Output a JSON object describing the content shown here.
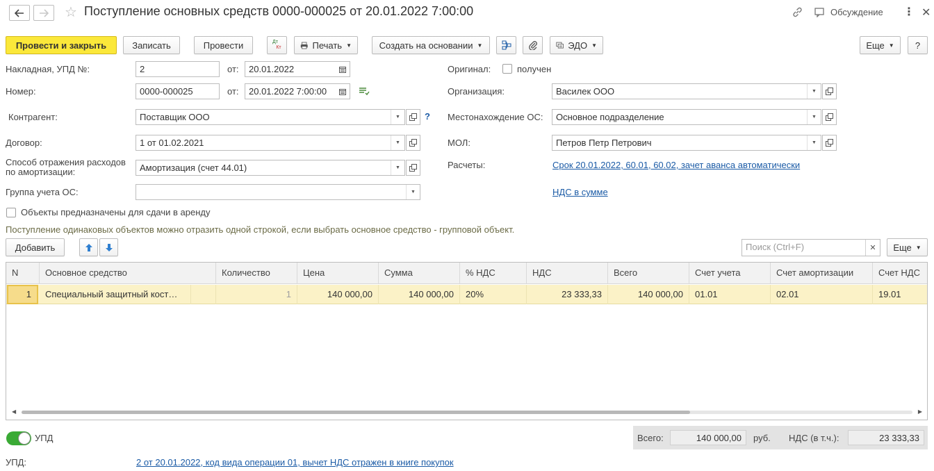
{
  "window": {
    "title": "Поступление основных средств 0000-000025 от 20.01.2022 7:00:00",
    "discussion_label": "Обсуждение"
  },
  "toolbar": {
    "post_close_label": "Провести и закрыть",
    "save_label": "Записать",
    "post_label": "Провести",
    "dtkt_top": "Дт",
    "dtkt_bottom": "Кт",
    "print_label": "Печать",
    "create_based_label": "Создать на основании",
    "edo_label": "ЭДО",
    "more_label": "Еще",
    "help_label": "?"
  },
  "form": {
    "invoice_label": "Накладная, УПД №:",
    "invoice_value": "2",
    "from_label": "от:",
    "invoice_date": "20.01.2022",
    "number_label": "Номер:",
    "number_value": "0000-000025",
    "number_date": "20.01.2022  7:00:00",
    "counterparty_label": "Контрагент:",
    "counterparty_value": "Поставщик ООО",
    "contract_label": "Договор:",
    "contract_value": "1 от 01.02.2021",
    "method_label_1": "Способ отражения расходов",
    "method_label_2": "по амортизации:",
    "method_value": "Амортизация (счет 44.01)",
    "group_label": "Группа учета ОС:",
    "group_value": "",
    "original_label": "Оригинал:",
    "original_check_label": "получен",
    "org_label": "Организация:",
    "org_value": "Василек ООО",
    "location_label": "Местонахождение ОС:",
    "location_value": "Основное подразделение",
    "mol_label": "МОЛ:",
    "mol_value": "Петров Петр Петрович",
    "settlements_label": "Расчеты:",
    "settlements_link": "Срок 20.01.2022, 60.01, 60.02, зачет аванса автоматически",
    "vat_link": "НДС в сумме",
    "lease_check_label": "Объекты предназначены для сдачи в аренду",
    "hint": "Поступление одинаковых объектов можно отразить одной строкой, если выбрать основное средство - групповой объект.",
    "add_label": "Добавить",
    "search_placeholder": "Поиск (Ctrl+F)",
    "table_more_label": "Еще"
  },
  "table": {
    "columns": [
      "N",
      "Основное средство",
      "Количество",
      "Цена",
      "Сумма",
      "% НДС",
      "НДС",
      "Всего",
      "Счет учета",
      "Счет амортизации",
      "Счет НДС"
    ],
    "rows": [
      {
        "n": "1",
        "asset": "Специальный защитный кост…",
        "qty": "1",
        "price": "140 000,00",
        "sum": "140 000,00",
        "vat_rate": "20%",
        "vat": "23 333,33",
        "total": "140 000,00",
        "account": "01.01",
        "depr_account": "02.01",
        "vat_account": "19.01"
      }
    ]
  },
  "footer": {
    "upd_toggle_label": "УПД",
    "total_label": "Всего:",
    "total_value": "140 000,00",
    "currency": "руб.",
    "vat_incl_label": "НДС (в т.ч.):",
    "vat_value": "23 333,33",
    "upd_label": "УПД:",
    "upd_link": "2 от 20.01.2022, код вида операции 01, вычет НДС отражен в книге покупок"
  },
  "colors": {
    "primary_button": "#fbe83a",
    "link": "#1b5ba6",
    "selected_row": "#fbf2c7",
    "toggle_on": "#3aaa35"
  }
}
